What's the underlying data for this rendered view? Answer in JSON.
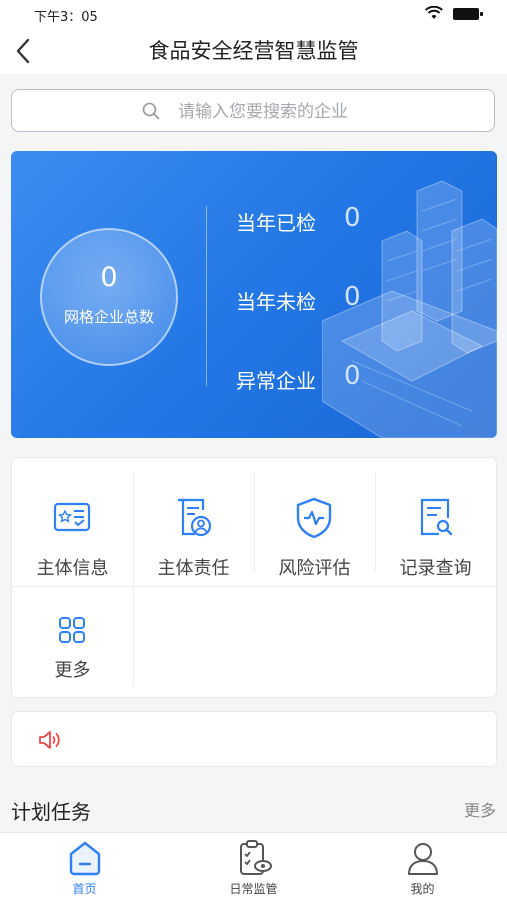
{
  "status_bar": {
    "time": "下午3：05"
  },
  "nav": {
    "title": "食品安全经营智慧监管"
  },
  "search": {
    "placeholder": "请输入您要搜索的企业"
  },
  "stats": {
    "total_value": "0",
    "total_label": "网格企业总数",
    "items": [
      {
        "label": "当年已检",
        "value": "0"
      },
      {
        "label": "当年未检",
        "value": "0"
      },
      {
        "label": "异常企业",
        "value": "0"
      }
    ]
  },
  "menu": {
    "items": [
      {
        "label": "主体信息",
        "icon": "id-card-icon"
      },
      {
        "label": "主体责任",
        "icon": "document-user-icon"
      },
      {
        "label": "风险评估",
        "icon": "shield-pulse-icon"
      },
      {
        "label": "记录查询",
        "icon": "document-search-icon"
      },
      {
        "label": "更多",
        "icon": "grid-icon"
      }
    ]
  },
  "notice": {
    "icon": "speaker-icon"
  },
  "plan": {
    "title": "计划任务",
    "more": "更多"
  },
  "tabs": [
    {
      "label": "首页",
      "icon": "home-icon",
      "active": true
    },
    {
      "label": "日常监管",
      "icon": "clipboard-eye-icon",
      "active": false
    },
    {
      "label": "我的",
      "icon": "user-icon",
      "active": false
    }
  ],
  "colors": {
    "primary": "#2f7ff5",
    "card_gradient_start": "#3d8df0",
    "card_gradient_end": "#1a66d6",
    "alert": "#e94b4b"
  }
}
